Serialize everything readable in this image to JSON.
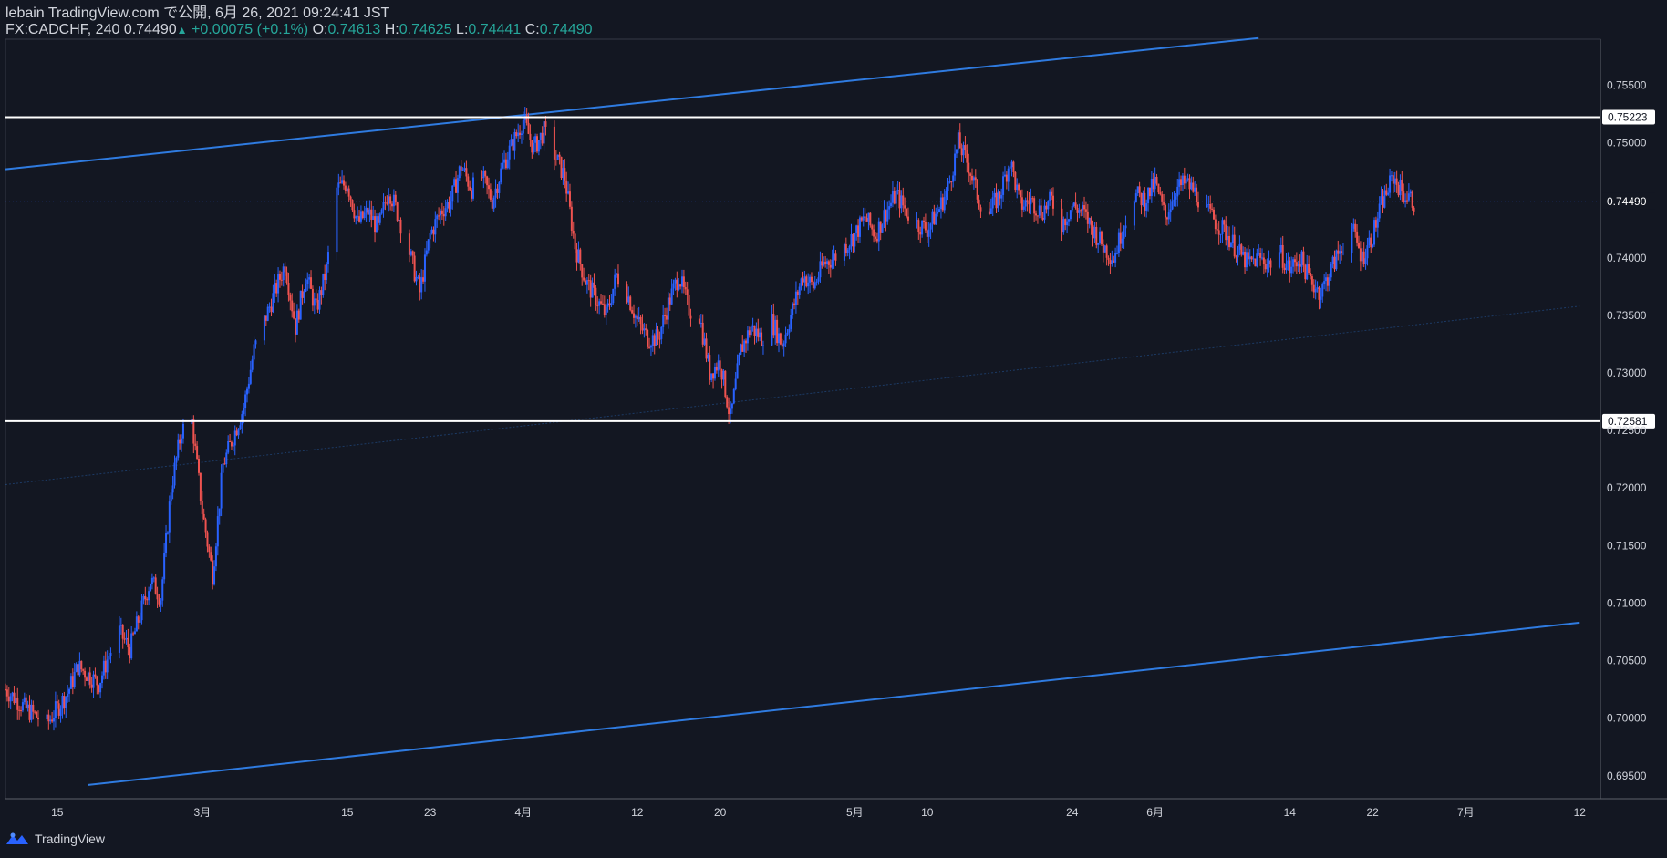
{
  "header": {
    "line1": "lebain TradingView.com で公開, 6月 26, 2021 09:24:41 JST",
    "symbol": "FX:CADCHF, 240",
    "last": "0.74490",
    "change": "+0.00075 (+0.1%)",
    "o_label": "O:",
    "o_value": "0.74613",
    "h_label": "H:",
    "h_value": "0.74625",
    "l_label": "L:",
    "l_value": "0.74441",
    "c_label": "C:",
    "c_value": "0.74490"
  },
  "footer": {
    "brand": "TradingView"
  },
  "colors": {
    "background": "#131722",
    "up": "#2962ff",
    "down": "#ef5350",
    "trendline": "#2f7be0",
    "level": "#ffffff",
    "text": "#d1d4dc",
    "green": "#26a69a"
  },
  "chart_data": {
    "type": "candlestick",
    "symbol": "FX:CADCHF",
    "interval": "240",
    "ylim": [
      0.693,
      0.759
    ],
    "y_ticks": [
      "0.75500",
      "0.75000",
      "0.74500",
      "0.74000",
      "0.73500",
      "0.73000",
      "0.72500",
      "0.72000",
      "0.71500",
      "0.71000",
      "0.70500",
      "0.70000",
      "0.69500"
    ],
    "x_ticks": [
      {
        "label": "15",
        "date": "2021-02-15"
      },
      {
        "label": "3月",
        "date": "2021-03-01"
      },
      {
        "label": "15",
        "date": "2021-03-15"
      },
      {
        "label": "23",
        "date": "2021-03-23"
      },
      {
        "label": "4月",
        "date": "2021-04-01"
      },
      {
        "label": "12",
        "date": "2021-04-12"
      },
      {
        "label": "20",
        "date": "2021-04-20"
      },
      {
        "label": "5月",
        "date": "2021-05-03"
      },
      {
        "label": "10",
        "date": "2021-05-10"
      },
      {
        "label": "24",
        "date": "2021-05-24"
      },
      {
        "label": "6月",
        "date": "2021-06-01"
      },
      {
        "label": "14",
        "date": "2021-06-14"
      },
      {
        "label": "22",
        "date": "2021-06-22"
      },
      {
        "label": "7月",
        "date": "2021-07-01"
      },
      {
        "label": "12",
        "date": "2021-07-12"
      }
    ],
    "last_price": "0.74490",
    "horizontal_levels": [
      {
        "value": 0.75223,
        "label": "0.75223"
      },
      {
        "value": 0.72581,
        "label": "0.72581"
      }
    ],
    "trendlines": [
      {
        "name": "channel-upper",
        "from": {
          "date": "2021-02-10",
          "price": 0.7477
        },
        "to": {
          "date": "2021-06-11",
          "price": 0.7591
        }
      },
      {
        "name": "channel-lower",
        "from": {
          "date": "2021-02-18",
          "price": 0.6942
        },
        "to": {
          "date": "2021-07-12",
          "price": 0.7083
        }
      },
      {
        "name": "channel-mid",
        "from": {
          "date": "2021-02-10",
          "price": 0.7203
        },
        "to": {
          "date": "2021-07-12",
          "price": 0.7358
        }
      }
    ],
    "close_path": [
      [
        "2021-02-10",
        0.7025
      ],
      [
        "2021-02-12",
        0.7008
      ],
      [
        "2021-02-14",
        0.6995
      ],
      [
        "2021-02-16",
        0.7022
      ],
      [
        "2021-02-17",
        0.7045
      ],
      [
        "2021-02-19",
        0.703
      ],
      [
        "2021-02-20",
        0.7055
      ],
      [
        "2021-02-21",
        0.7075
      ],
      [
        "2021-02-22",
        0.706
      ],
      [
        "2021-02-23",
        0.709
      ],
      [
        "2021-02-24",
        0.712
      ],
      [
        "2021-02-25",
        0.7105
      ],
      [
        "2021-02-26",
        0.72
      ],
      [
        "2021-02-27",
        0.725
      ],
      [
        "2021-02-28",
        0.7258
      ],
      [
        "2021-03-01",
        0.718
      ],
      [
        "2021-03-02",
        0.7125
      ],
      [
        "2021-03-03",
        0.722
      ],
      [
        "2021-03-04",
        0.7245
      ],
      [
        "2021-03-05",
        0.727
      ],
      [
        "2021-03-06",
        0.732
      ],
      [
        "2021-03-07",
        0.7345
      ],
      [
        "2021-03-08",
        0.737
      ],
      [
        "2021-03-09",
        0.7395
      ],
      [
        "2021-03-10",
        0.734
      ],
      [
        "2021-03-11",
        0.7385
      ],
      [
        "2021-03-12",
        0.7355
      ],
      [
        "2021-03-13",
        0.739
      ],
      [
        "2021-03-14",
        0.746
      ],
      [
        "2021-03-15",
        0.7465
      ],
      [
        "2021-03-16",
        0.743
      ],
      [
        "2021-03-17",
        0.744
      ],
      [
        "2021-03-18",
        0.7425
      ],
      [
        "2021-03-19",
        0.746
      ],
      [
        "2021-03-20",
        0.7435
      ],
      [
        "2021-03-21",
        0.7405
      ],
      [
        "2021-03-22",
        0.737
      ],
      [
        "2021-03-23",
        0.742
      ],
      [
        "2021-03-24",
        0.744
      ],
      [
        "2021-03-25",
        0.745
      ],
      [
        "2021-03-26",
        0.748
      ],
      [
        "2021-03-27",
        0.746
      ],
      [
        "2021-03-28",
        0.747
      ],
      [
        "2021-03-29",
        0.745
      ],
      [
        "2021-03-30",
        0.748
      ],
      [
        "2021-03-31",
        0.75
      ],
      [
        "2021-04-01",
        0.752
      ],
      [
        "2021-04-02",
        0.7495
      ],
      [
        "2021-04-03",
        0.751
      ],
      [
        "2021-04-04",
        0.749
      ],
      [
        "2021-04-05",
        0.747
      ],
      [
        "2021-04-06",
        0.741
      ],
      [
        "2021-04-07",
        0.738
      ],
      [
        "2021-04-08",
        0.7365
      ],
      [
        "2021-04-09",
        0.735
      ],
      [
        "2021-04-10",
        0.7385
      ],
      [
        "2021-04-11",
        0.737
      ],
      [
        "2021-04-12",
        0.7345
      ],
      [
        "2021-04-13",
        0.733
      ],
      [
        "2021-04-14",
        0.733
      ],
      [
        "2021-04-15",
        0.736
      ],
      [
        "2021-04-16",
        0.7385
      ],
      [
        "2021-04-17",
        0.7355
      ],
      [
        "2021-04-18",
        0.735
      ],
      [
        "2021-04-19",
        0.73
      ],
      [
        "2021-04-20",
        0.731
      ],
      [
        "2021-04-21",
        0.726
      ],
      [
        "2021-04-22",
        0.732
      ],
      [
        "2021-04-23",
        0.734
      ],
      [
        "2021-04-24",
        0.733
      ],
      [
        "2021-04-25",
        0.7345
      ],
      [
        "2021-04-26",
        0.7325
      ],
      [
        "2021-04-27",
        0.7355
      ],
      [
        "2021-04-28",
        0.7385
      ],
      [
        "2021-04-29",
        0.7375
      ],
      [
        "2021-04-30",
        0.7395
      ],
      [
        "2021-05-01",
        0.74
      ],
      [
        "2021-05-02",
        0.741
      ],
      [
        "2021-05-03",
        0.742
      ],
      [
        "2021-05-04",
        0.7435
      ],
      [
        "2021-05-05",
        0.742
      ],
      [
        "2021-05-06",
        0.744
      ],
      [
        "2021-05-07",
        0.7455
      ],
      [
        "2021-05-08",
        0.744
      ],
      [
        "2021-05-09",
        0.743
      ],
      [
        "2021-05-10",
        0.7425
      ],
      [
        "2021-05-11",
        0.744
      ],
      [
        "2021-05-12",
        0.746
      ],
      [
        "2021-05-13",
        0.75
      ],
      [
        "2021-05-14",
        0.748
      ],
      [
        "2021-05-15",
        0.745
      ],
      [
        "2021-05-16",
        0.744
      ],
      [
        "2021-05-17",
        0.7455
      ],
      [
        "2021-05-18",
        0.7485
      ],
      [
        "2021-05-19",
        0.7445
      ],
      [
        "2021-05-20",
        0.745
      ],
      [
        "2021-05-21",
        0.744
      ],
      [
        "2021-05-22",
        0.745
      ],
      [
        "2021-05-23",
        0.743
      ],
      [
        "2021-05-24",
        0.7445
      ],
      [
        "2021-05-25",
        0.744
      ],
      [
        "2021-05-26",
        0.7425
      ],
      [
        "2021-05-27",
        0.741
      ],
      [
        "2021-05-28",
        0.74
      ],
      [
        "2021-05-29",
        0.743
      ],
      [
        "2021-05-30",
        0.7455
      ],
      [
        "2021-05-31",
        0.745
      ],
      [
        "2021-06-01",
        0.7465
      ],
      [
        "2021-06-02",
        0.7435
      ],
      [
        "2021-06-03",
        0.746
      ],
      [
        "2021-06-04",
        0.7465
      ],
      [
        "2021-06-05",
        0.7455
      ],
      [
        "2021-06-06",
        0.744
      ],
      [
        "2021-06-07",
        0.743
      ],
      [
        "2021-06-08",
        0.742
      ],
      [
        "2021-06-09",
        0.7405
      ],
      [
        "2021-06-10",
        0.7395
      ],
      [
        "2021-06-11",
        0.74
      ],
      [
        "2021-06-12",
        0.7395
      ],
      [
        "2021-06-13",
        0.7405
      ],
      [
        "2021-06-14",
        0.739
      ],
      [
        "2021-06-15",
        0.74
      ],
      [
        "2021-06-16",
        0.738
      ],
      [
        "2021-06-17",
        0.737
      ],
      [
        "2021-06-18",
        0.739
      ],
      [
        "2021-06-19",
        0.741
      ],
      [
        "2021-06-20",
        0.7425
      ],
      [
        "2021-06-21",
        0.74
      ],
      [
        "2021-06-22",
        0.742
      ],
      [
        "2021-06-23",
        0.745
      ],
      [
        "2021-06-24",
        0.747
      ],
      [
        "2021-06-25",
        0.7455
      ],
      [
        "2021-06-26",
        0.7449
      ]
    ]
  }
}
